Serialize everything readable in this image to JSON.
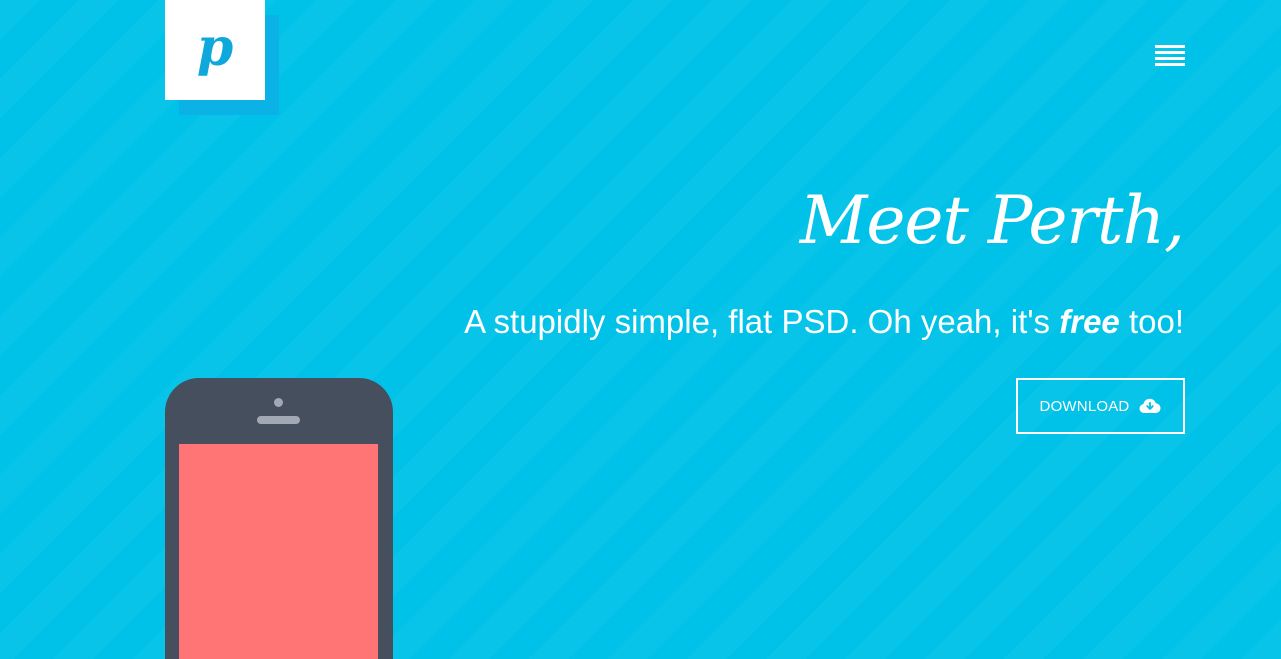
{
  "brand": {
    "logo_letter": "p",
    "logo_icon": "logo-mark"
  },
  "nav": {
    "menu_icon": "hamburger-menu-icon"
  },
  "hero": {
    "headline": "Meet Perth,",
    "tagline_before": "A stupidly simple, flat PSD. Oh yeah, it's ",
    "tagline_emphasis": "free",
    "tagline_after": " too!",
    "download_label": "DOWNLOAD",
    "download_icon": "cloud-download-icon"
  },
  "device": {
    "type": "phone-illustration"
  },
  "colors": {
    "background": "#00c2e8",
    "logo_shadow": "#0ab2e6",
    "logo_letter": "#0ea8dc",
    "phone_body": "#454f5e",
    "phone_screen": "#ff7575",
    "text": "#ffffff"
  }
}
